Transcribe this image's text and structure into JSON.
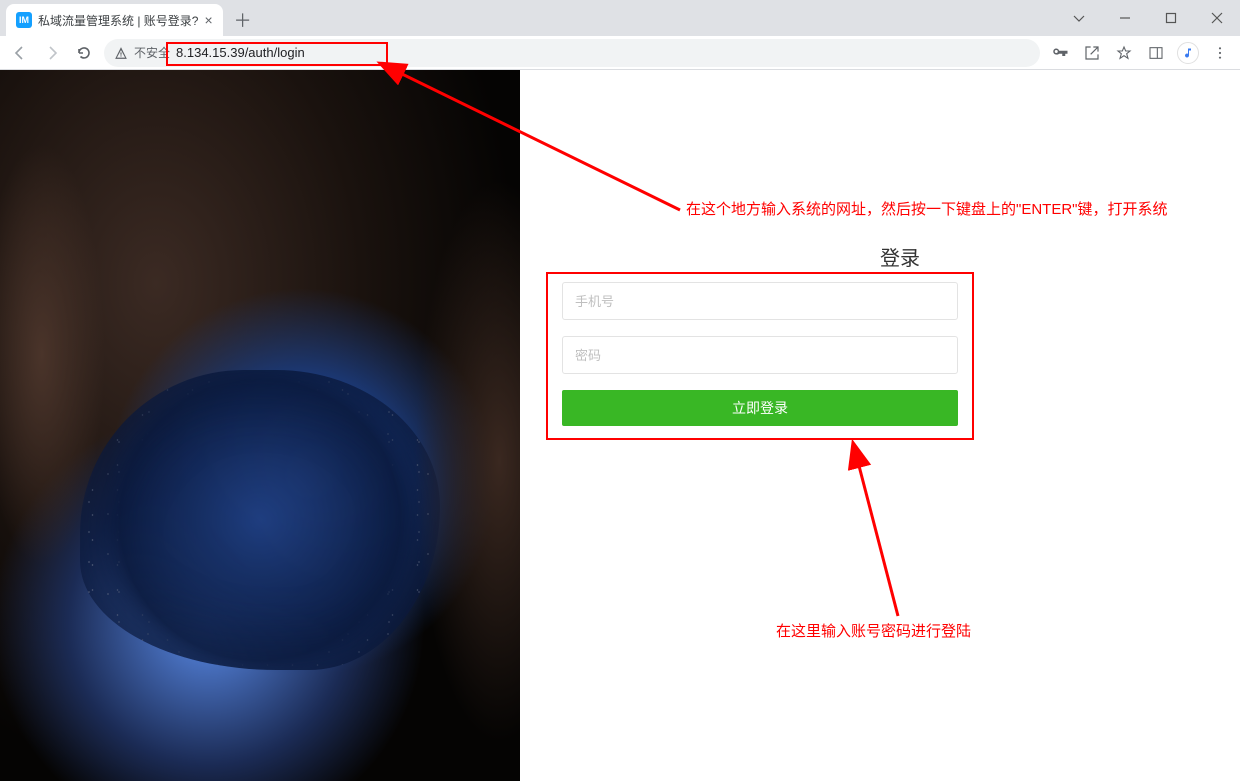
{
  "browser": {
    "tab_title": "私域流量管理系统 | 账号登录?",
    "favicon_text": "IM",
    "not_secure_label": "不安全",
    "url": "8.134.15.39/auth/login"
  },
  "login": {
    "title": "登录",
    "phone_placeholder": "手机号",
    "password_placeholder": "密码",
    "submit_label": "立即登录"
  },
  "annotations": {
    "addr_hint": "在这个地方输入系统的网址，然后按一下键盘上的\"ENTER\"键，打开系统",
    "form_hint": "在这里输入账号密码进行登陆"
  },
  "colors": {
    "annotation": "#ff0000",
    "primary_button": "#39b725"
  }
}
